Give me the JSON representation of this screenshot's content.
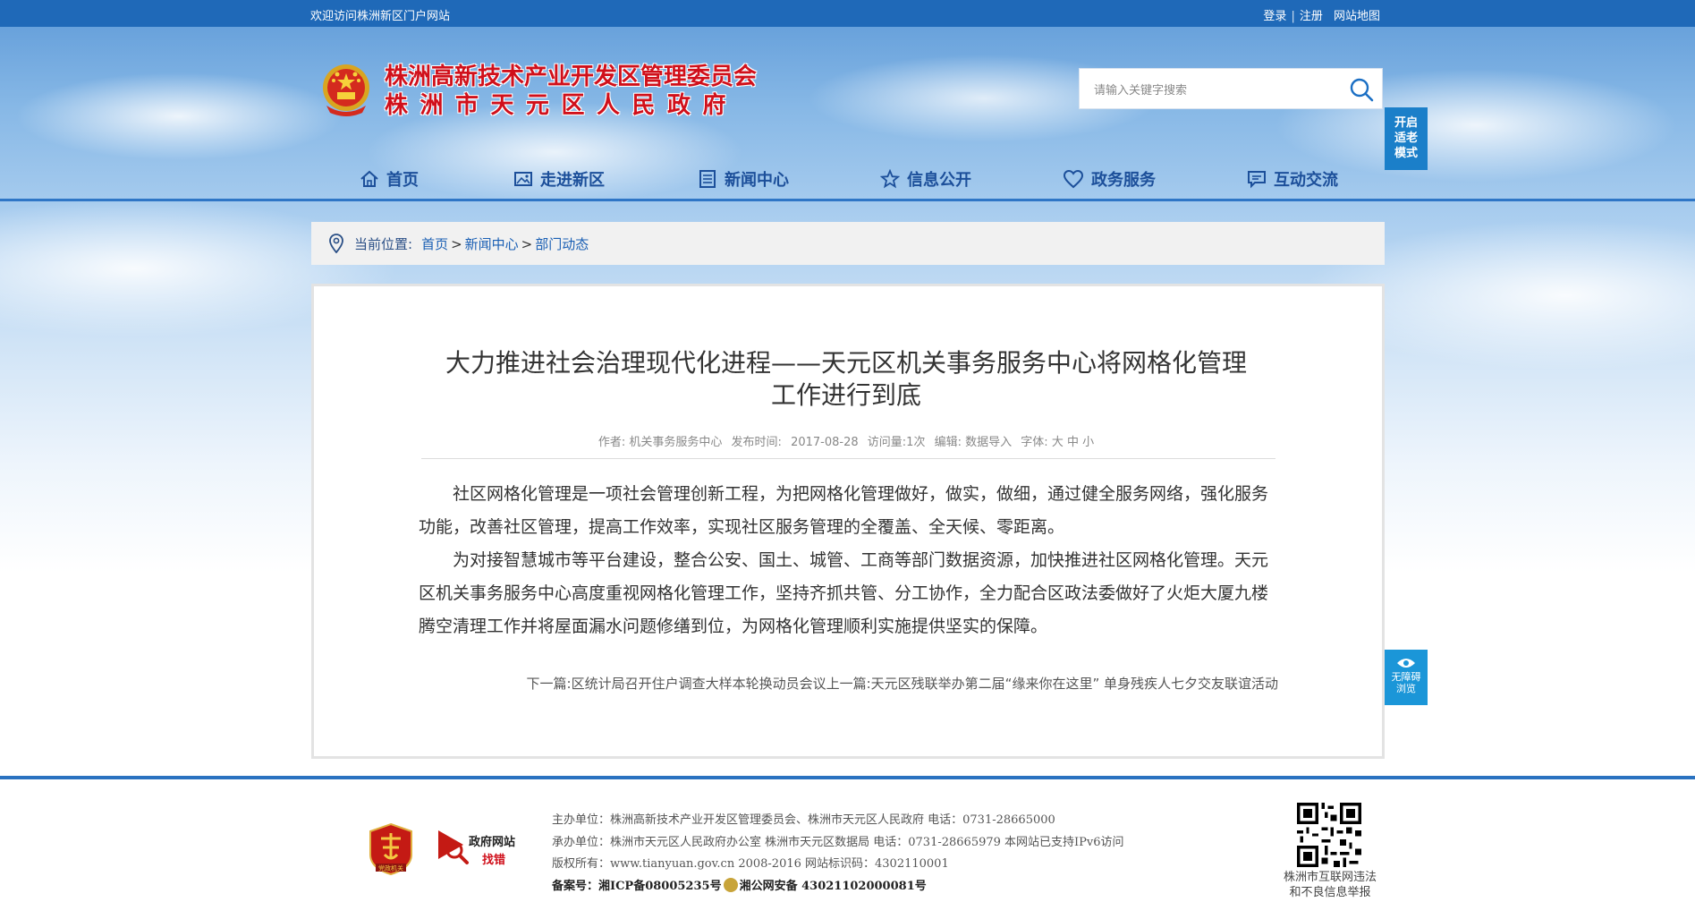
{
  "topbar": {
    "welcome": "欢迎访问株洲新区门户网站",
    "login": "登录",
    "register": "注册",
    "sitemap": "网站地图",
    "separator": "|"
  },
  "header": {
    "title_line1": "株洲高新技术产业开发区管理委员会",
    "title_line2": "株洲市天元区人民政府",
    "emblem_icon": "national-emblem-icon",
    "search_placeholder": "请输入关键字搜索",
    "search_icon": "search-icon"
  },
  "side": {
    "elder_mode": [
      "开启",
      "适老",
      "模式"
    ],
    "accessible_line1": "无障碍",
    "accessible_line2": "浏览"
  },
  "nav": {
    "items": [
      {
        "label": "首页",
        "icon": "home-icon"
      },
      {
        "label": "走进新区",
        "icon": "picture-icon"
      },
      {
        "label": "新闻中心",
        "icon": "newspaper-icon"
      },
      {
        "label": "信息公开",
        "icon": "star-icon"
      },
      {
        "label": "政务服务",
        "icon": "heart-icon"
      },
      {
        "label": "互动交流",
        "icon": "chat-icon"
      }
    ]
  },
  "breadcrumb": {
    "label": "当前位置:",
    "items": [
      "首页",
      "新闻中心",
      "部门动态"
    ],
    "separator": ">"
  },
  "article": {
    "title_line1": "大力推进社会治理现代化进程——天元区机关事务服务中心将网格化管理",
    "title_line2": "工作进行到底",
    "meta": {
      "author_label": "作者:",
      "author": "机关事务服务中心",
      "published_label": "发布时间:",
      "published": "2017-08-28",
      "visits_label": "访问量:",
      "visits": "1次",
      "editor_label": "编辑:",
      "editor": "数据导入",
      "font_label": "字体:",
      "font_large": "大",
      "font_medium": "中",
      "font_small": "小"
    },
    "paragraphs": [
      "社区网格化管理是一项社会管理创新工程，为把网格化管理做好，做实，做细，通过健全服务网络，强化服务功能，改善社区管理，提高工作效率，实现社区服务管理的全覆盖、全天候、零距离。",
      "为对接智慧城市等平台建设，整合公安、国土、城管、工商等部门数据资源，加快推进社区网格化管理。天元区机关事务服务中心高度重视网格化管理工作，坚持齐抓共管、分工协作，全力配合区政法委做好了火炬大厦九楼腾空清理工作并将屋面漏水问题修缮到位，为网格化管理顺利实施提供坚实的保障。"
    ],
    "next_label": "下一篇:",
    "next_title": "区统计局召开住户调查大样本轮换动员会议",
    "prev_label": "上一篇:",
    "prev_title": "天元区残联举办第二届“缘来你在这里” 单身残疾人七夕交友联谊活动"
  },
  "footer": {
    "badge1_text": "党政机关",
    "badge2_line1": "政府网站",
    "badge2_line2": "找错",
    "line1": "主办单位：株洲高新技术产业开发区管理委员会、株洲市天元区人民政府 电话：0731-28665000",
    "line2": "承办单位：株洲市天元区人民政府办公室 株洲市天元区数据局 电话：0731-28665979 本网站已支持IPv6访问",
    "line3": "版权所有：www.tianyuan.gov.cn 2008-2016 网站标识码：4302110001",
    "line4a": "备案号：湘ICP备08005235号",
    "line4b": "湘公网安备 43021102000081号",
    "qr_caption_line1": "株洲市互联网违法",
    "qr_caption_line2": "和不良信息举报"
  },
  "colors": {
    "topbar": "#1f69b8",
    "title_red": "#d0101b",
    "nav_text": "#1c4f9a",
    "side_button": "#1b7fc9"
  }
}
